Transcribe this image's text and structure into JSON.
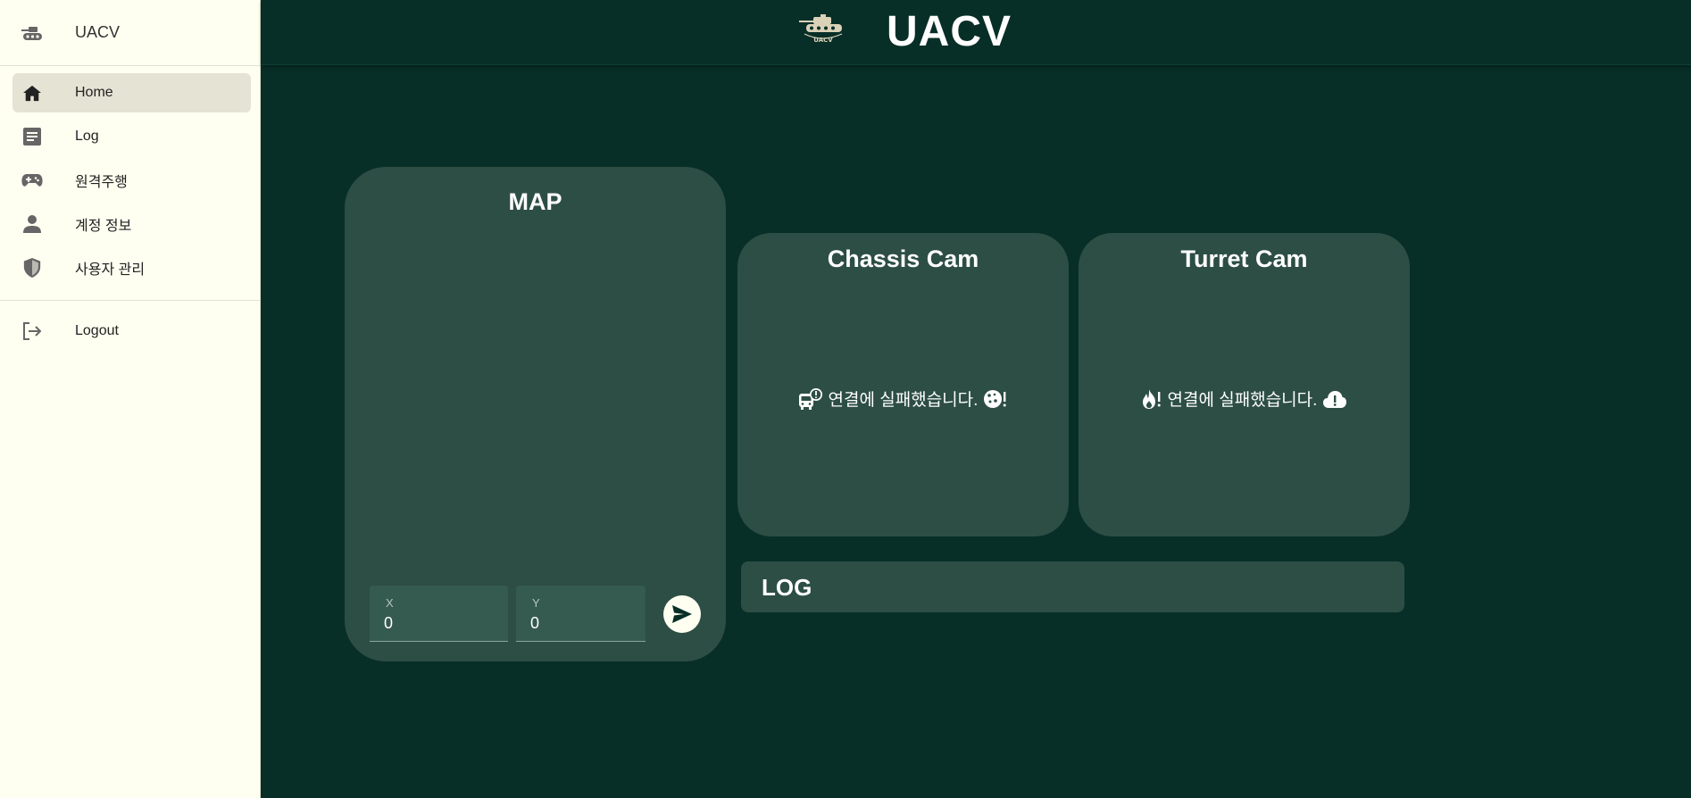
{
  "sidebar": {
    "brand": "UACV",
    "items": [
      {
        "label": "Home",
        "icon": "home-icon",
        "active": true
      },
      {
        "label": "Log",
        "icon": "article-icon"
      },
      {
        "label": "원격주행",
        "icon": "gamepad-icon"
      },
      {
        "label": "계정 정보",
        "icon": "person-icon"
      },
      {
        "label": "사용자 관리",
        "icon": "shield-icon"
      }
    ],
    "logout": "Logout"
  },
  "header": {
    "title": "UACV",
    "logo_text": "UACV"
  },
  "map": {
    "title": "MAP",
    "x_label": "X",
    "x_value": "0",
    "y_label": "Y",
    "y_value": "0"
  },
  "cams": {
    "chassis": {
      "title": "Chassis Cam",
      "message": "연결에 실패했습니다."
    },
    "turret": {
      "title": "Turret Cam",
      "message": "연결에 실패했습니다."
    }
  },
  "log": {
    "title": "LOG"
  },
  "colors": {
    "background": "#082f27",
    "panel": "#2d4e44",
    "sidebar": "#fffff1",
    "sidebar_active": "#e4e3d4"
  }
}
